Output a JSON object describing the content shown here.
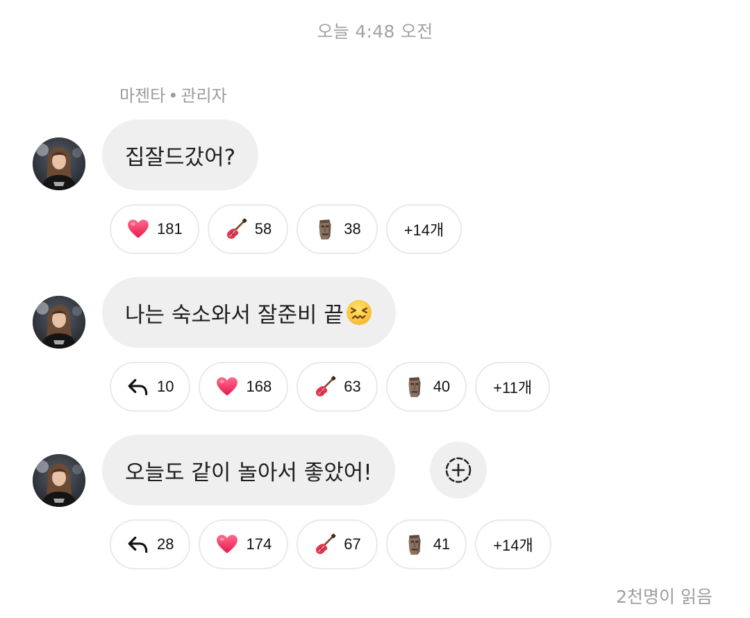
{
  "timestamp": "오늘 4:48 오전",
  "sender": {
    "name": "마젠타",
    "separator": "•",
    "role": "관리자"
  },
  "messages": [
    {
      "text": "집잘드갔어?",
      "reactions": [
        {
          "icon": "heart-icon",
          "count": "181"
        },
        {
          "icon": "guitar-icon",
          "count": "58"
        },
        {
          "icon": "moai-icon",
          "count": "38"
        }
      ],
      "more": "+14개"
    },
    {
      "text": "나는 숙소와서 잘준비 끝",
      "trailing_emoji": "confounded-face-icon",
      "reply_count": "10",
      "reactions": [
        {
          "icon": "heart-icon",
          "count": "168"
        },
        {
          "icon": "guitar-icon",
          "count": "63"
        },
        {
          "icon": "moai-icon",
          "count": "40"
        }
      ],
      "more": "+11개"
    },
    {
      "text": "오늘도 같이 놀아서 좋았어!",
      "reply_count": "28",
      "reactions": [
        {
          "icon": "heart-icon",
          "count": "174"
        },
        {
          "icon": "guitar-icon",
          "count": "67"
        },
        {
          "icon": "moai-icon",
          "count": "41"
        }
      ],
      "more": "+14개"
    }
  ],
  "read_count": "2천명이 읽음",
  "colors": {
    "bubble": "#efefef",
    "muted_text": "#a2a2a2",
    "pill_border": "#e9e9e9",
    "heart": "#f0355f"
  }
}
